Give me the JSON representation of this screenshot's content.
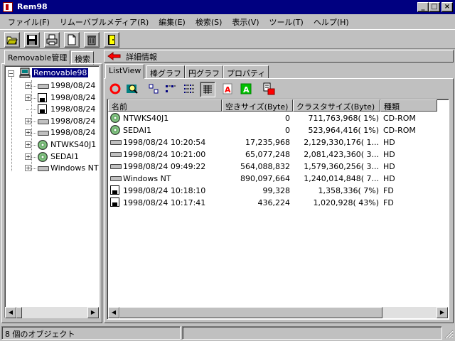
{
  "window": {
    "title": "Rem98"
  },
  "menu": [
    "ファイル(F)",
    "リムーバブルメディア(R)",
    "編集(E)",
    "検索(S)",
    "表示(V)",
    "ツール(T)",
    "ヘルプ(H)"
  ],
  "toolbar_icons": [
    "open-folder-icon",
    "save-icon",
    "print-icon",
    "new-document-icon",
    "trash-icon",
    "exit-icon"
  ],
  "left_tabs": [
    "Removable管理",
    "検索"
  ],
  "detail": {
    "label": "詳細情報"
  },
  "tree": {
    "root": "Removable98",
    "items": [
      {
        "label": "1998/08/24",
        "type": "hd",
        "expand": true
      },
      {
        "label": "1998/08/24",
        "type": "floppy",
        "expand": true
      },
      {
        "label": "1998/08/24",
        "type": "floppy",
        "expand": false
      },
      {
        "label": "1998/08/24",
        "type": "hd",
        "expand": true
      },
      {
        "label": "1998/08/24",
        "type": "hd",
        "expand": true
      },
      {
        "label": "NTWKS40J1",
        "type": "cd",
        "expand": true
      },
      {
        "label": "SEDAI1",
        "type": "cd",
        "expand": true
      },
      {
        "label": "Windows NT",
        "type": "hd",
        "expand": true
      }
    ]
  },
  "view_tabs": [
    "ListView",
    "棒グラフ",
    "円グラフ",
    "プロパティ"
  ],
  "list": {
    "columns": [
      "名前",
      "空きサイズ(Byte)",
      "クラスタサイズ(Byte)",
      "種類"
    ],
    "rows": [
      {
        "name": "NTWKS40J1",
        "free": "0",
        "cluster": "711,763,968(  1%)",
        "kind": "CD-ROM",
        "type": "cd"
      },
      {
        "name": "SEDAI1",
        "free": "0",
        "cluster": "523,964,416(  1%)",
        "kind": "CD-ROM",
        "type": "cd"
      },
      {
        "name": "1998/08/24 10:20:54",
        "free": "17,235,968",
        "cluster": "2,129,330,176(  1...",
        "kind": "HD",
        "type": "hd"
      },
      {
        "name": "1998/08/24 10:21:00",
        "free": "65,077,248",
        "cluster": "2,081,423,360(  3...",
        "kind": "HD",
        "type": "hd"
      },
      {
        "name": "1998/08/24 09:49:22",
        "free": "564,088,832",
        "cluster": "1,579,360,256(  3...",
        "kind": "HD",
        "type": "hd"
      },
      {
        "name": "Windows NT",
        "free": "890,097,664",
        "cluster": "1,240,014,848(  7...",
        "kind": "HD",
        "type": "hd"
      },
      {
        "name": "1998/08/24 10:18:10",
        "free": "99,328",
        "cluster": "1,358,336(  7%)",
        "kind": "FD",
        "type": "floppy"
      },
      {
        "name": "1998/08/24 10:17:41",
        "free": "436,224",
        "cluster": "1,020,928( 43%)",
        "kind": "FD",
        "type": "floppy"
      }
    ]
  },
  "status": {
    "text": "8 個のオブジェクト"
  }
}
